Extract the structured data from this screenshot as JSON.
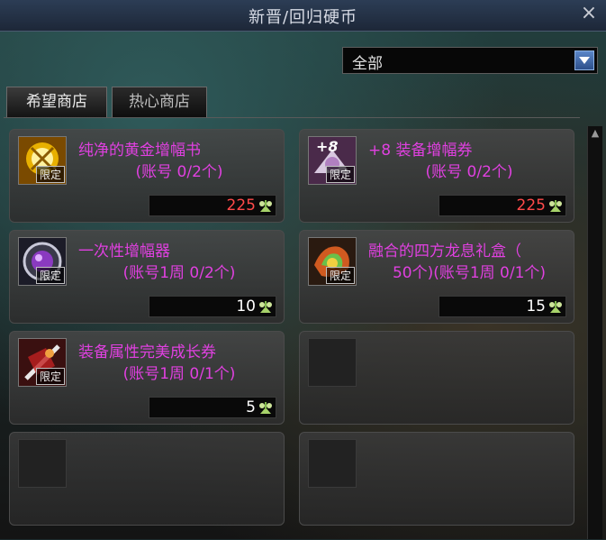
{
  "window": {
    "title": "新晋/回归硬币",
    "close": "×"
  },
  "filter": {
    "selected": "全部"
  },
  "tabs": [
    {
      "label": "希望商店",
      "active": true
    },
    {
      "label": "热心商店",
      "active": false
    }
  ],
  "items": [
    {
      "name": "纯净的黄金增幅书",
      "limit": "(账号 0/2个)",
      "badge": "限定",
      "price": "225",
      "price_color": "#ff4a4a",
      "icon": "golden-amplify-book-icon"
    },
    {
      "name": "+8 装备增幅券",
      "limit": "(账号 0/2个)",
      "badge": "限定",
      "overlay": "+8",
      "price": "225",
      "price_color": "#ff4a4a",
      "icon": "amplify-ticket-icon"
    },
    {
      "name": "一次性增幅器",
      "limit": "(账号1周 0/2个)",
      "badge": "限定",
      "price": "10",
      "price_color": "#ffffff",
      "icon": "amplifier-icon"
    },
    {
      "name": "融合的四方龙息礼盒（",
      "limit": "50个)(账号1周 0/1个)",
      "badge": "限定",
      "price": "15",
      "price_color": "#ffffff",
      "icon": "dragon-breath-box-icon"
    },
    {
      "name": "装备属性完美成长券",
      "limit": "(账号1周 0/1个)",
      "badge": "限定",
      "price": "5",
      "price_color": "#ffffff",
      "icon": "growth-ticket-icon"
    }
  ],
  "scroll": {
    "up": "▲"
  }
}
